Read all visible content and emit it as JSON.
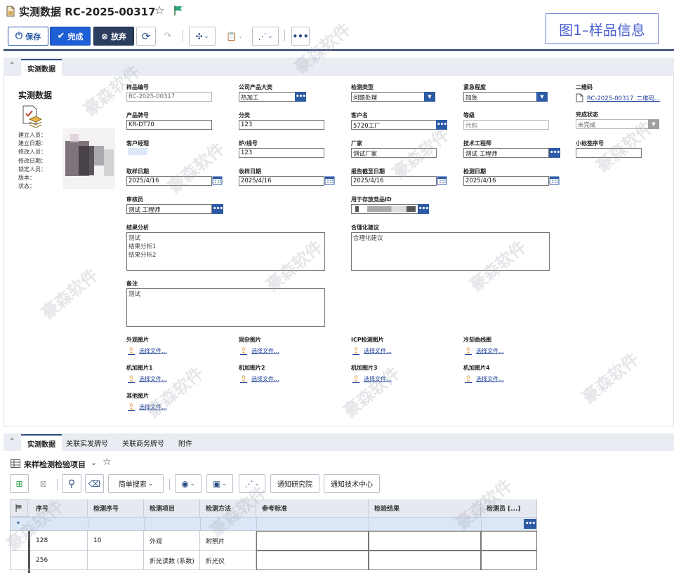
{
  "header": {
    "title": "实测数据 RC-2025-00317",
    "caption": "图1–样品信息"
  },
  "toolbar": {
    "save": "保存",
    "done": "完成",
    "abandon": "放弃"
  },
  "panel1": {
    "tab": "实测数据",
    "side_title": "实测数据",
    "meta": [
      "建立人员：",
      "建立日期：",
      "修改人员：",
      "修改日期：",
      "锁定人员：",
      "版本：",
      "状态："
    ],
    "fields": {
      "sample_no": {
        "label": "样品编号",
        "value": "RC-2025-00317"
      },
      "company_category": {
        "label": "公司产品大类",
        "value": "热加工"
      },
      "inspect_type": {
        "label": "检测类型",
        "value": "问题处理"
      },
      "urgency": {
        "label": "紧急程度",
        "value": "加急"
      },
      "qrcode": {
        "label": "二维码",
        "value": "RC-2025-00317_二维码..."
      },
      "brand": {
        "label": "产品牌号",
        "value": "KR-DT70"
      },
      "classify": {
        "label": "分类",
        "value": "123"
      },
      "customer": {
        "label": "客户名",
        "value": "5720工厂"
      },
      "grade": {
        "label": "等级",
        "value": "代购"
      },
      "finish_status": {
        "label": "完成状态",
        "value": "未完成"
      },
      "manager": {
        "label": "客户经理",
        "value": ""
      },
      "furnace": {
        "label": "炉/线号",
        "value": "123"
      },
      "factory": {
        "label": "厂家",
        "value": "测试厂家"
      },
      "engineer": {
        "label": "技术工程师",
        "value": "测试 工程师"
      },
      "label_seq": {
        "label": "小标签序号",
        "value": ""
      },
      "sample_date": {
        "label": "取样日期",
        "value": "2025/4/16"
      },
      "receive_date": {
        "label": "收样日期",
        "value": "2025/4/16"
      },
      "report_date": {
        "label": "报告截至日期",
        "value": "2025/4/16"
      },
      "check_date": {
        "label": "检测日期",
        "value": "2025/4/16"
      },
      "reviewer": {
        "label": "审核员",
        "value": "测试 工程师"
      },
      "storage_id": {
        "label": "用于存放竞品ID",
        "value": ""
      },
      "analysis": {
        "label": "结果分析",
        "value": "测试\n结果分析1\n结果分析2"
      },
      "suggestion": {
        "label": "合理化建议",
        "value": "合理化建议"
      },
      "remark": {
        "label": "备注",
        "value": "测试"
      }
    },
    "uploads": {
      "choose": "选择文件...",
      "items": [
        "外观图片",
        "固杂图片",
        "ICP检测图片",
        "冷却曲线图",
        "机加图片1",
        "机加图片2",
        "机加图片3",
        "机加图片4",
        "其他图片"
      ]
    }
  },
  "panel2": {
    "tabs": [
      "实测数据",
      "关联实发牌号",
      "关联商务牌号",
      "附件"
    ],
    "title": "来样检测检验项目",
    "search_mode": "简单搜索",
    "notify_institute": "通知研究院",
    "notify_center": "通知技术中心",
    "columns": [
      "序号",
      "检测序号",
      "检测项目",
      "检测方法",
      "参考标准",
      "检验结果",
      "检测员 [...]"
    ],
    "rows": [
      [
        "128",
        "10",
        "外观",
        "附照片",
        "",
        "",
        ""
      ],
      [
        "256",
        "",
        "折光读数 (系数)",
        "折光仪",
        "",
        "",
        ""
      ]
    ]
  },
  "watermark": "豪森软件"
}
